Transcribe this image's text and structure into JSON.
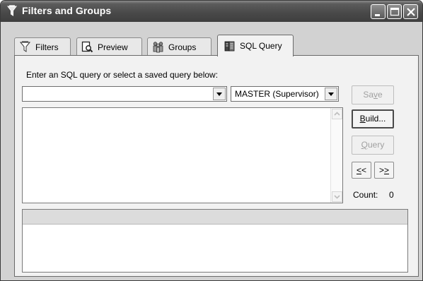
{
  "window": {
    "title": "Filters and Groups"
  },
  "tabs": [
    {
      "label": "Filters",
      "icon": "funnel-icon",
      "active": false
    },
    {
      "label": "Preview",
      "icon": "preview-icon",
      "active": false
    },
    {
      "label": "Groups",
      "icon": "groups-icon",
      "active": false
    },
    {
      "label": "SQL Query",
      "icon": "sql-book-icon",
      "active": true
    }
  ],
  "sql": {
    "prompt": "Enter an SQL query or select a saved query below:",
    "saved_query_value": "",
    "database_value": "MASTER (Supervisor)",
    "query_text": ""
  },
  "buttons": {
    "save": {
      "pre": "Sa",
      "key": "v",
      "post": "e",
      "enabled": false
    },
    "build": {
      "pre": "",
      "key": "B",
      "post": "uild...",
      "enabled": true
    },
    "query": {
      "pre": "",
      "key": "Q",
      "post": "uery",
      "enabled": false
    },
    "prev": {
      "pre": "",
      "key": "<",
      "post": "<",
      "enabled": true
    },
    "next": {
      "pre": ">",
      "key": ">",
      "post": "",
      "enabled": true
    }
  },
  "count": {
    "label": "Count:",
    "value": "0"
  },
  "colors": {
    "titlebar": "#4a4a4a",
    "panel": "#f2f2f2",
    "window": "#d2d2d2"
  }
}
